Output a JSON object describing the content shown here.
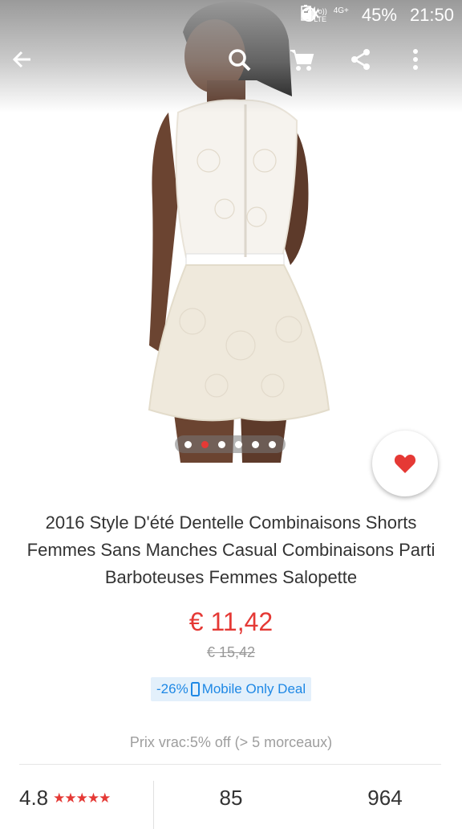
{
  "status_bar": {
    "volte": "Vo))",
    "lte": "LTE",
    "network": "4G+",
    "battery": "45%",
    "time": "21:50"
  },
  "toolbar": {
    "icons": [
      "back-arrow-icon",
      "search-icon",
      "cart-icon",
      "share-icon",
      "more-vert-icon"
    ]
  },
  "gallery": {
    "dot_count": 6,
    "active_index": 1
  },
  "product": {
    "title": "2016 Style D'été Dentelle Combinaisons Shorts Femmes Sans Manches Casual Combinaisons Parti Barboteuses Femmes Salopette",
    "price": "€ 11,42",
    "original_price": "€ 15,42",
    "discount": "-26%",
    "deal_label": "Mobile Only Deal",
    "bulk_price": "Prix vrac:5% off (> 5 morceaux)"
  },
  "stats": {
    "rating": "4.8",
    "stars": "★★★★★",
    "reviews": "85",
    "orders": "964"
  },
  "colors": {
    "accent": "#e53935",
    "deal_blue": "#1e88e5",
    "deal_bg": "#e3f0fb"
  }
}
